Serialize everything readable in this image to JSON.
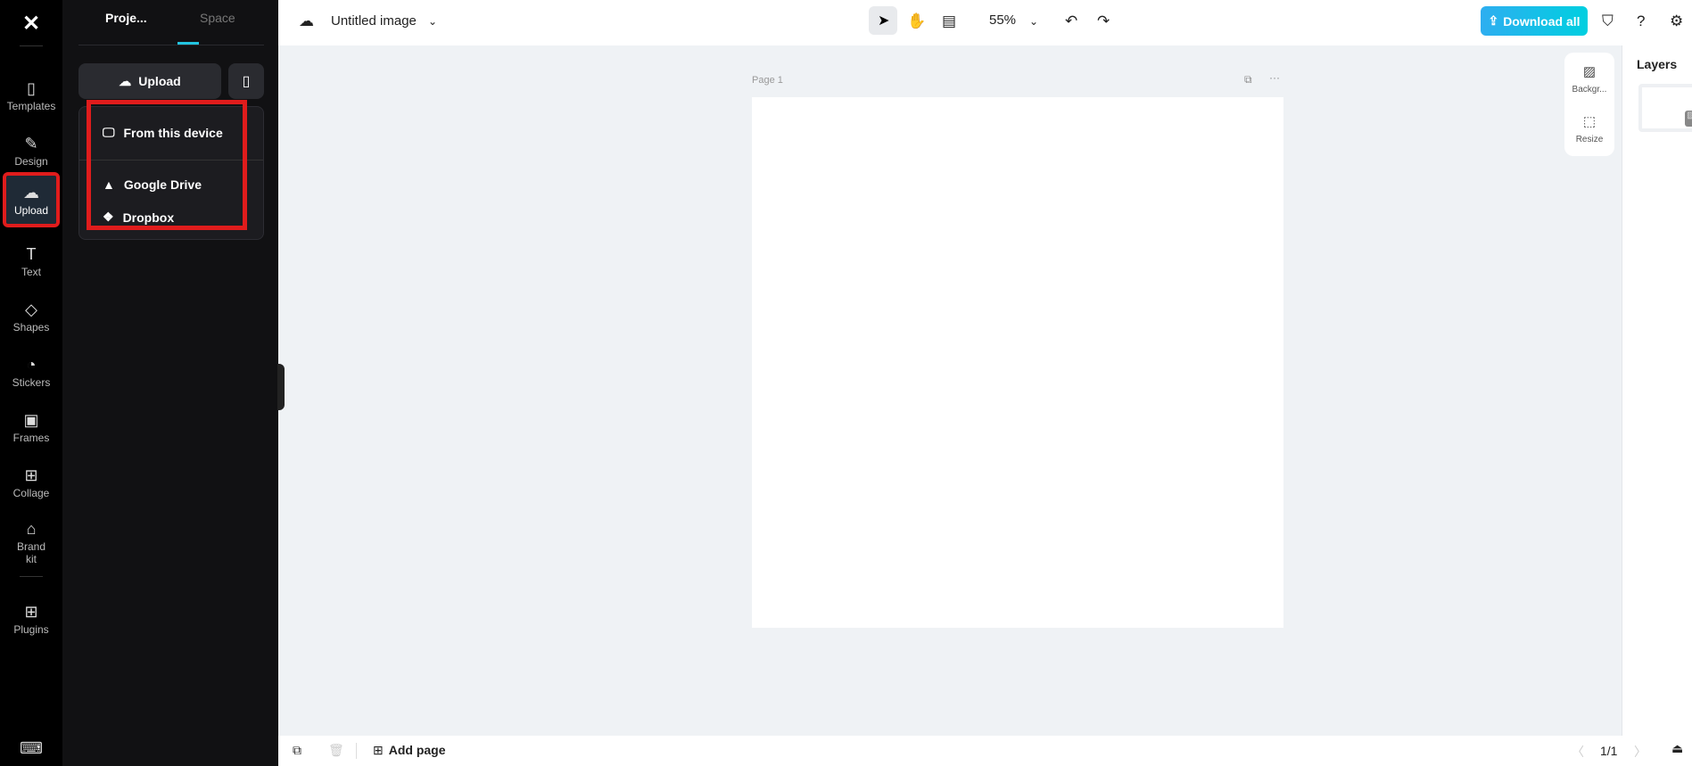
{
  "rail": {
    "items": [
      {
        "label": "Templates",
        "icon": "▯"
      },
      {
        "label": "Design",
        "icon": "✎"
      },
      {
        "label": "Upload",
        "icon": "☁"
      },
      {
        "label": "Text",
        "icon": "T"
      },
      {
        "label": "Shapes",
        "icon": "◇"
      },
      {
        "label": "Stickers",
        "icon": "◔"
      },
      {
        "label": "Frames",
        "icon": "▣"
      },
      {
        "label": "Collage",
        "icon": "⊞"
      },
      {
        "label": "Brand kit",
        "icon": "⌂"
      },
      {
        "label": "Plugins",
        "icon": "⊞"
      }
    ]
  },
  "panel": {
    "tabs": [
      "Proje...",
      "Space"
    ],
    "upload_label": "Upload",
    "menu": [
      "From this device",
      "Google Drive",
      "Dropbox"
    ]
  },
  "top": {
    "title": "Untitled image",
    "zoom": "55%",
    "download": "Download all"
  },
  "canvas": {
    "page_label": "Page 1"
  },
  "float": {
    "background": "Backgr...",
    "resize": "Resize"
  },
  "right": {
    "title": "Layers"
  },
  "bottom": {
    "add_page": "Add page",
    "page_count": "1/1"
  },
  "colors": {
    "accent": "#22c4e0",
    "highlight": "#e01c1c"
  }
}
